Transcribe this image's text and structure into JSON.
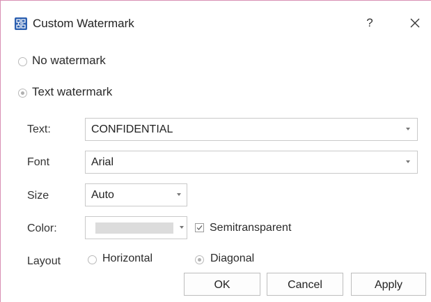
{
  "window": {
    "title": "Custom Watermark",
    "help_label": "?",
    "close_icon": "close-icon",
    "app_icon": "watermark-app-icon",
    "accent_color": "#2b5fb0",
    "border_color": "#d88fb4"
  },
  "watermark_type": {
    "options": [
      {
        "label": "No watermark",
        "checked": false
      },
      {
        "label": "Text watermark",
        "checked": true
      }
    ]
  },
  "form": {
    "text": {
      "label": "Text:",
      "value": "CONFIDENTIAL"
    },
    "font": {
      "label": "Font",
      "value": "Arial"
    },
    "size": {
      "label": "Size",
      "value": "Auto"
    },
    "color": {
      "label": "Color:",
      "swatch": "#dcdcdc"
    },
    "semitransparent": {
      "label": "Semitransparent",
      "checked": true
    },
    "layout": {
      "label": "Layout",
      "options": [
        {
          "label": "Horizontal",
          "checked": false
        },
        {
          "label": "Diagonal",
          "checked": true
        }
      ]
    }
  },
  "buttons": {
    "ok": "OK",
    "cancel": "Cancel",
    "apply": "Apply"
  }
}
